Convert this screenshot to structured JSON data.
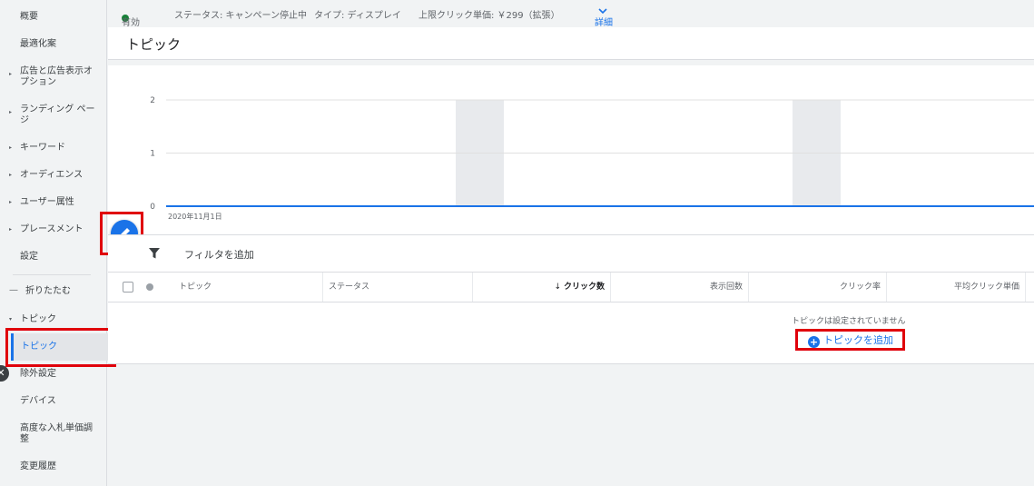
{
  "sidebar": {
    "items": [
      {
        "label": "概要",
        "expandable": false
      },
      {
        "label": "最適化案",
        "expandable": false
      },
      {
        "label": "広告と広告表示オプション",
        "expandable": true
      },
      {
        "label": "ランディング ページ",
        "expandable": true
      },
      {
        "label": "キーワード",
        "expandable": true
      },
      {
        "label": "オーディエンス",
        "expandable": true
      },
      {
        "label": "ユーザー属性",
        "expandable": true
      },
      {
        "label": "プレースメント",
        "expandable": true
      },
      {
        "label": "設定",
        "expandable": false
      }
    ],
    "collapse_label": "折りたたむ",
    "group_label": "トピック",
    "sub_items": [
      {
        "label": "トピック",
        "selected": true
      },
      {
        "label": "除外設定",
        "selected": false
      }
    ],
    "bottom_items": [
      {
        "label": "デバイス"
      },
      {
        "label": "高度な入札単価調整"
      },
      {
        "label": "変更履歴"
      }
    ]
  },
  "status_bar": {
    "status": "有効",
    "campaign_status": "ステータス: キャンペーン停止中",
    "type": "タイプ: ディスプレイ",
    "max_cpc": "上限クリック単価: ￥299（拡張）",
    "details_label": "詳細"
  },
  "page_title": "トピック",
  "chart_data": {
    "type": "line",
    "x": [
      "2020年11月1日"
    ],
    "series": [
      {
        "values": [
          0
        ]
      }
    ],
    "ylim": [
      0,
      2
    ],
    "y_ticks": [
      "0",
      "1",
      "2"
    ],
    "x_tick_label": "2020年11月1日",
    "grid": true,
    "line_color": "#1a73e8"
  },
  "filter": {
    "label": "フィルタを追加"
  },
  "table": {
    "columns": [
      "トピック",
      "ステータス",
      "クリック数",
      "表示回数",
      "クリック率",
      "平均クリック単価"
    ],
    "sorted_column": "クリック数",
    "empty_message": "トピックは設定されていません",
    "add_label": "トピックを追加"
  },
  "colors": {
    "accent": "#1a73e8",
    "highlight": "#e0000b",
    "status_green": "#188038"
  }
}
